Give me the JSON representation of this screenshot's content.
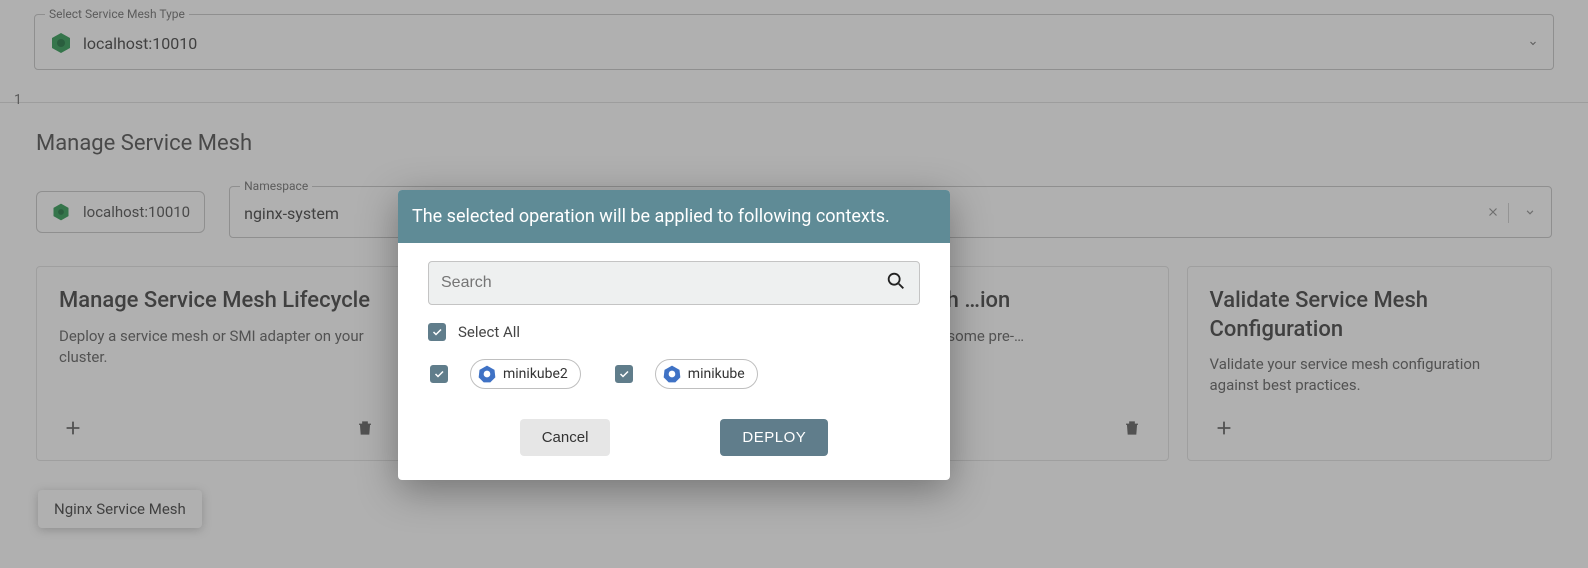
{
  "topSelect": {
    "label": "Select Service Mesh Type",
    "value": "localhost:10010"
  },
  "stepNumber": "1",
  "section": {
    "title": "Manage Service Mesh"
  },
  "hostChip": {
    "text": "localhost:10010"
  },
  "namespace": {
    "label": "Namespace",
    "value": "nginx-system"
  },
  "cards": [
    {
      "title": "Manage Service Mesh Lifecycle",
      "desc": "Deploy a service mesh or SMI adapter on your cluster."
    },
    {
      "title": "",
      "desc": ""
    },
    {
      "title": "Service Mesh …ion",
      "desc": "…vice mesh using some pre-…"
    },
    {
      "title": "Validate Service Mesh Configuration",
      "desc": "Validate your service mesh configuration against best practices."
    }
  ],
  "tooltip": {
    "text": "Nginx Service Mesh"
  },
  "dialog": {
    "title": "The selected operation will be applied to following contexts.",
    "searchPlaceholder": "Search",
    "selectAll": "Select All",
    "contexts": [
      {
        "name": "minikube2"
      },
      {
        "name": "minikube"
      }
    ],
    "cancel": "Cancel",
    "deploy": "DEPLOY"
  }
}
